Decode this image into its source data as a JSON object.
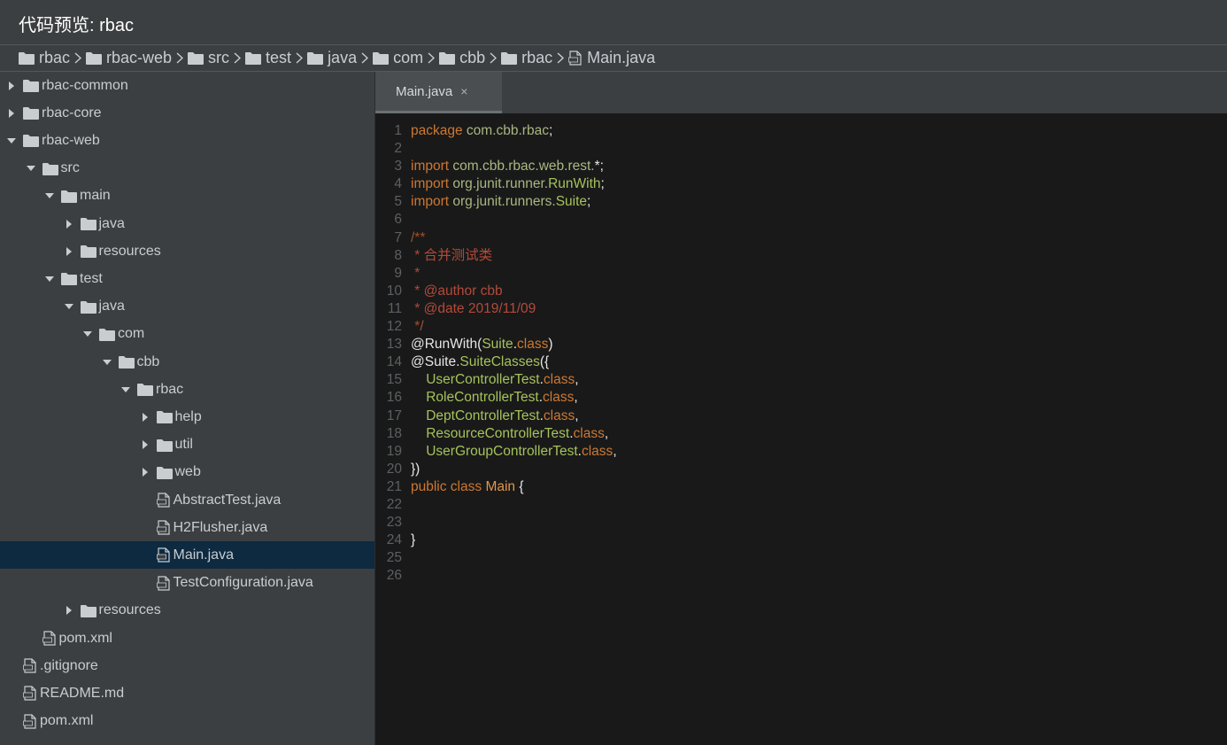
{
  "header": {
    "title": "代码预览: rbac"
  },
  "breadcrumb": [
    {
      "label": "rbac",
      "icon": "folder-icon"
    },
    {
      "label": "rbac-web",
      "icon": "folder-icon"
    },
    {
      "label": "src",
      "icon": "folder-icon"
    },
    {
      "label": "test",
      "icon": "folder-icon"
    },
    {
      "label": "java",
      "icon": "folder-icon"
    },
    {
      "label": "com",
      "icon": "folder-icon"
    },
    {
      "label": "cbb",
      "icon": "folder-icon"
    },
    {
      "label": "rbac",
      "icon": "folder-icon"
    },
    {
      "label": "Main.java",
      "icon": "file-icon"
    }
  ],
  "tree": [
    {
      "label": "rbac-common",
      "type": "folder",
      "expanded": false
    },
    {
      "label": "rbac-core",
      "type": "folder",
      "expanded": false
    },
    {
      "label": "rbac-web",
      "type": "folder",
      "expanded": true
    },
    {
      "label": "src",
      "type": "folder",
      "expanded": true
    },
    {
      "label": "main",
      "type": "folder",
      "expanded": true
    },
    {
      "label": "java",
      "type": "folder",
      "expanded": false
    },
    {
      "label": "resources",
      "type": "folder",
      "expanded": false
    },
    {
      "label": "test",
      "type": "folder",
      "expanded": true
    },
    {
      "label": "java",
      "type": "folder",
      "expanded": true
    },
    {
      "label": "com",
      "type": "folder",
      "expanded": true
    },
    {
      "label": "cbb",
      "type": "folder",
      "expanded": true
    },
    {
      "label": "rbac",
      "type": "folder",
      "expanded": true
    },
    {
      "label": "help",
      "type": "folder",
      "expanded": false
    },
    {
      "label": "util",
      "type": "folder",
      "expanded": false
    },
    {
      "label": "web",
      "type": "folder",
      "expanded": false
    },
    {
      "label": "AbstractTest.java",
      "type": "file"
    },
    {
      "label": "H2Flusher.java",
      "type": "file"
    },
    {
      "label": "Main.java",
      "type": "file",
      "selected": true
    },
    {
      "label": "TestConfiguration.java",
      "type": "file"
    },
    {
      "label": "resources",
      "type": "folder",
      "expanded": false
    },
    {
      "label": "pom.xml",
      "type": "file"
    },
    {
      "label": ".gitignore",
      "type": "file"
    },
    {
      "label": "README.md",
      "type": "file"
    },
    {
      "label": "pom.xml",
      "type": "file"
    }
  ],
  "editor": {
    "tab_label": "Main.java",
    "tab_close": "×",
    "lines": [
      {
        "n": "1",
        "tokens": [
          [
            "kw",
            "package "
          ],
          [
            "pk",
            "com.cbb.rbac"
          ],
          [
            "pl",
            ";"
          ]
        ]
      },
      {
        "n": "2",
        "tokens": []
      },
      {
        "n": "3",
        "tokens": [
          [
            "kw",
            "import "
          ],
          [
            "pk",
            "com.cbb.rbac.web.rest."
          ],
          [
            "pl",
            "*;"
          ]
        ]
      },
      {
        "n": "4",
        "tokens": [
          [
            "kw",
            "import "
          ],
          [
            "pk",
            "org.junit.runner."
          ],
          [
            "cl",
            "RunWith"
          ],
          [
            "pl",
            ";"
          ]
        ]
      },
      {
        "n": "5",
        "tokens": [
          [
            "kw",
            "import "
          ],
          [
            "pk",
            "org.junit.runners."
          ],
          [
            "cl",
            "Suite"
          ],
          [
            "pl",
            ";"
          ]
        ]
      },
      {
        "n": "6",
        "tokens": []
      },
      {
        "n": "7",
        "tokens": [
          [
            "cm",
            "/**"
          ]
        ]
      },
      {
        "n": "8",
        "tokens": [
          [
            "cmd",
            " * 合并测试类"
          ]
        ]
      },
      {
        "n": "9",
        "tokens": [
          [
            "cmd",
            " *"
          ]
        ]
      },
      {
        "n": "10",
        "tokens": [
          [
            "cmd",
            " * @author cbb"
          ]
        ]
      },
      {
        "n": "11",
        "tokens": [
          [
            "cmd",
            " * @date 2019/11/09"
          ]
        ]
      },
      {
        "n": "12",
        "tokens": [
          [
            "cm",
            " */"
          ]
        ]
      },
      {
        "n": "13",
        "tokens": [
          [
            "an",
            "@RunWith("
          ],
          [
            "cl",
            "Suite"
          ],
          [
            "pl",
            "."
          ],
          [
            "kw",
            "class"
          ],
          [
            "an",
            ")"
          ]
        ]
      },
      {
        "n": "14",
        "tokens": [
          [
            "an",
            "@Suite"
          ],
          [
            "pl",
            "."
          ],
          [
            "cl",
            "SuiteClasses"
          ],
          [
            "an",
            "({"
          ]
        ]
      },
      {
        "n": "15",
        "tokens": [
          [
            "pl",
            "    "
          ],
          [
            "cl",
            "UserControllerTest"
          ],
          [
            "pl",
            "."
          ],
          [
            "kw",
            "class"
          ],
          [
            "pl",
            ","
          ]
        ]
      },
      {
        "n": "16",
        "tokens": [
          [
            "pl",
            "    "
          ],
          [
            "cl",
            "RoleControllerTest"
          ],
          [
            "pl",
            "."
          ],
          [
            "kw",
            "class"
          ],
          [
            "pl",
            ","
          ]
        ]
      },
      {
        "n": "17",
        "tokens": [
          [
            "pl",
            "    "
          ],
          [
            "cl",
            "DeptControllerTest"
          ],
          [
            "pl",
            "."
          ],
          [
            "kw",
            "class"
          ],
          [
            "pl",
            ","
          ]
        ]
      },
      {
        "n": "18",
        "tokens": [
          [
            "pl",
            "    "
          ],
          [
            "cl",
            "ResourceControllerTest"
          ],
          [
            "pl",
            "."
          ],
          [
            "kw",
            "class"
          ],
          [
            "pl",
            ","
          ]
        ]
      },
      {
        "n": "19",
        "tokens": [
          [
            "pl",
            "    "
          ],
          [
            "cl",
            "UserGroupControllerTest"
          ],
          [
            "pl",
            "."
          ],
          [
            "kw",
            "class"
          ],
          [
            "pl",
            ","
          ]
        ]
      },
      {
        "n": "20",
        "tokens": [
          [
            "an",
            "})"
          ]
        ]
      },
      {
        "n": "21",
        "tokens": [
          [
            "kw",
            "public class "
          ],
          [
            "cls",
            "Main "
          ],
          [
            "pl",
            "{"
          ]
        ]
      },
      {
        "n": "22",
        "tokens": []
      },
      {
        "n": "23",
        "tokens": []
      },
      {
        "n": "24",
        "tokens": [
          [
            "pl",
            "}"
          ]
        ]
      },
      {
        "n": "25",
        "tokens": []
      },
      {
        "n": "26",
        "tokens": []
      }
    ]
  },
  "colors": {
    "background": "#3c3f41",
    "editor_bg": "#191919",
    "selection": "#0d2a40",
    "keyword": "#cc7832",
    "comment": "#a0522d"
  }
}
